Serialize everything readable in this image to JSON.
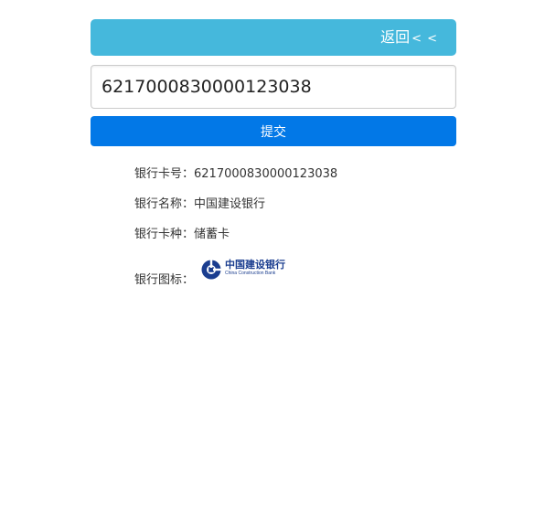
{
  "header": {
    "back_label": "返回",
    "back_arrows": "< <"
  },
  "form": {
    "card_number_value": "6217000830000123038",
    "submit_label": "提交"
  },
  "result": {
    "card_number": {
      "label": "银行卡号：",
      "value": "6217000830000123038"
    },
    "bank_name": {
      "label": "银行名称：",
      "value": "中国建设银行"
    },
    "card_type": {
      "label": "银行卡种：",
      "value": "储蓄卡"
    },
    "bank_logo": {
      "label": "银行图标：",
      "logo_text_cn": "中国建设银行",
      "logo_text_en": "China Construction Bank"
    }
  },
  "colors": {
    "header_bg": "#45b8dc",
    "submit_bg": "#0278e7",
    "logo_blue": "#1a3d8f"
  },
  "icons": {
    "logo": "ccb-logo-icon"
  }
}
